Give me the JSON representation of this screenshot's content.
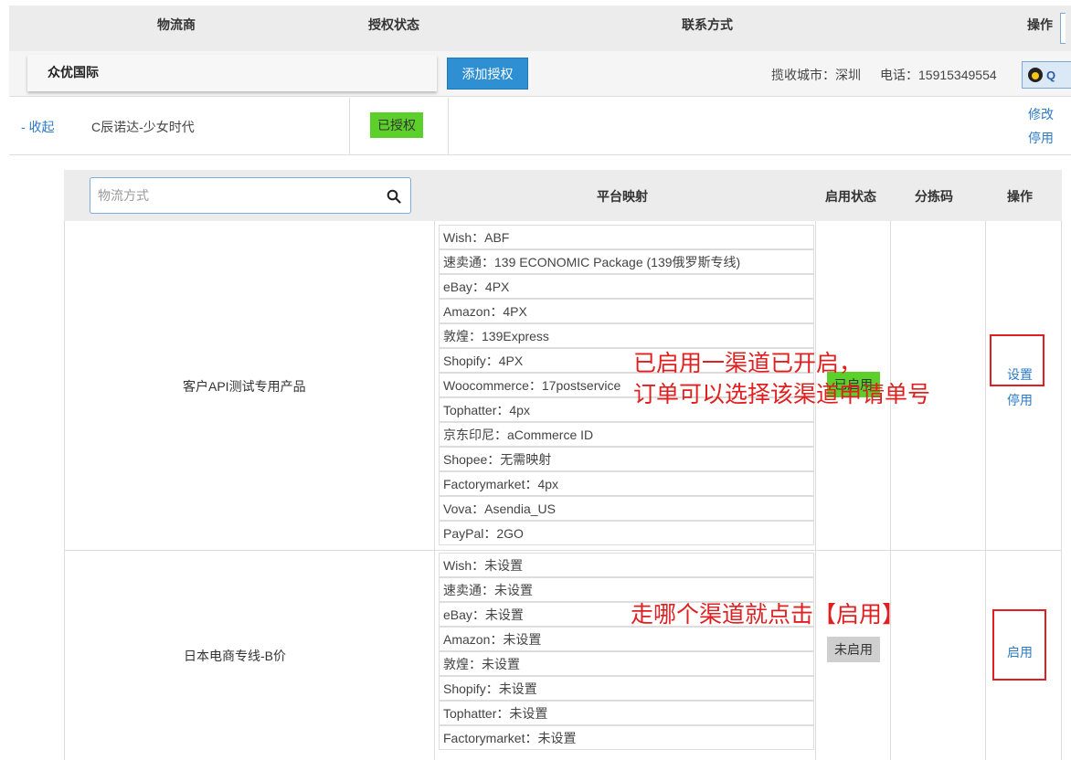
{
  "header": {
    "col_provider": "物流商",
    "col_auth_status": "授权状态",
    "col_contact": "联系方式",
    "col_action": "操作"
  },
  "provider": {
    "name": "众优国际",
    "add_auth_label": "添加授权",
    "pickup_city": "揽收城市：深圳",
    "phone": "电话：15915349554",
    "qq_label": "Q"
  },
  "sub_row": {
    "collapse_label": "- 收起",
    "store_name": "C辰诺达-少女时代",
    "auth_badge": "已授权",
    "modify_label": "修改",
    "disable_label": "停用"
  },
  "channel_table": {
    "search_placeholder": "物流方式",
    "col_platform_mapping": "平台映射",
    "col_enable_status": "启用状态",
    "col_sort_code": "分拣码",
    "col_action": "操作"
  },
  "channels": [
    {
      "name": "客户API测试专用产品",
      "status": "已启用",
      "action_settings": "设置",
      "action_disable": "停用",
      "mappings": [
        "Wish：ABF",
        "速卖通：139 ECONOMIC Package (139俄罗斯专线)",
        "eBay：4PX",
        "Amazon：4PX",
        "敦煌：139Express",
        "Shopify：4PX",
        "Woocommerce：17postservice",
        "Tophatter：4px",
        "京东印尼：aCommerce ID",
        "Shopee：无需映射",
        "Factorymarket：4px",
        "Vova：Asendia_US",
        "PayPal：2GO"
      ]
    },
    {
      "name": "日本电商专线-B价",
      "status": "未启用",
      "action_enable": "启用",
      "mappings": [
        "Wish：未设置",
        "速卖通：未设置",
        "eBay：未设置",
        "Amazon：未设置",
        "敦煌：未设置",
        "Shopify：未设置",
        "Tophatter：未设置",
        "Factorymarket：未设置"
      ]
    }
  ],
  "annotations": {
    "note1_line1": "已启用一渠道已开启，",
    "note1_line2": "订单可以选择该渠道申请单号",
    "note2": "走哪个渠道就点击【启用】"
  },
  "colors": {
    "accent_blue": "#2e8fd2",
    "enabled_green": "#5cd02a",
    "annotation_red": "#e02020"
  }
}
